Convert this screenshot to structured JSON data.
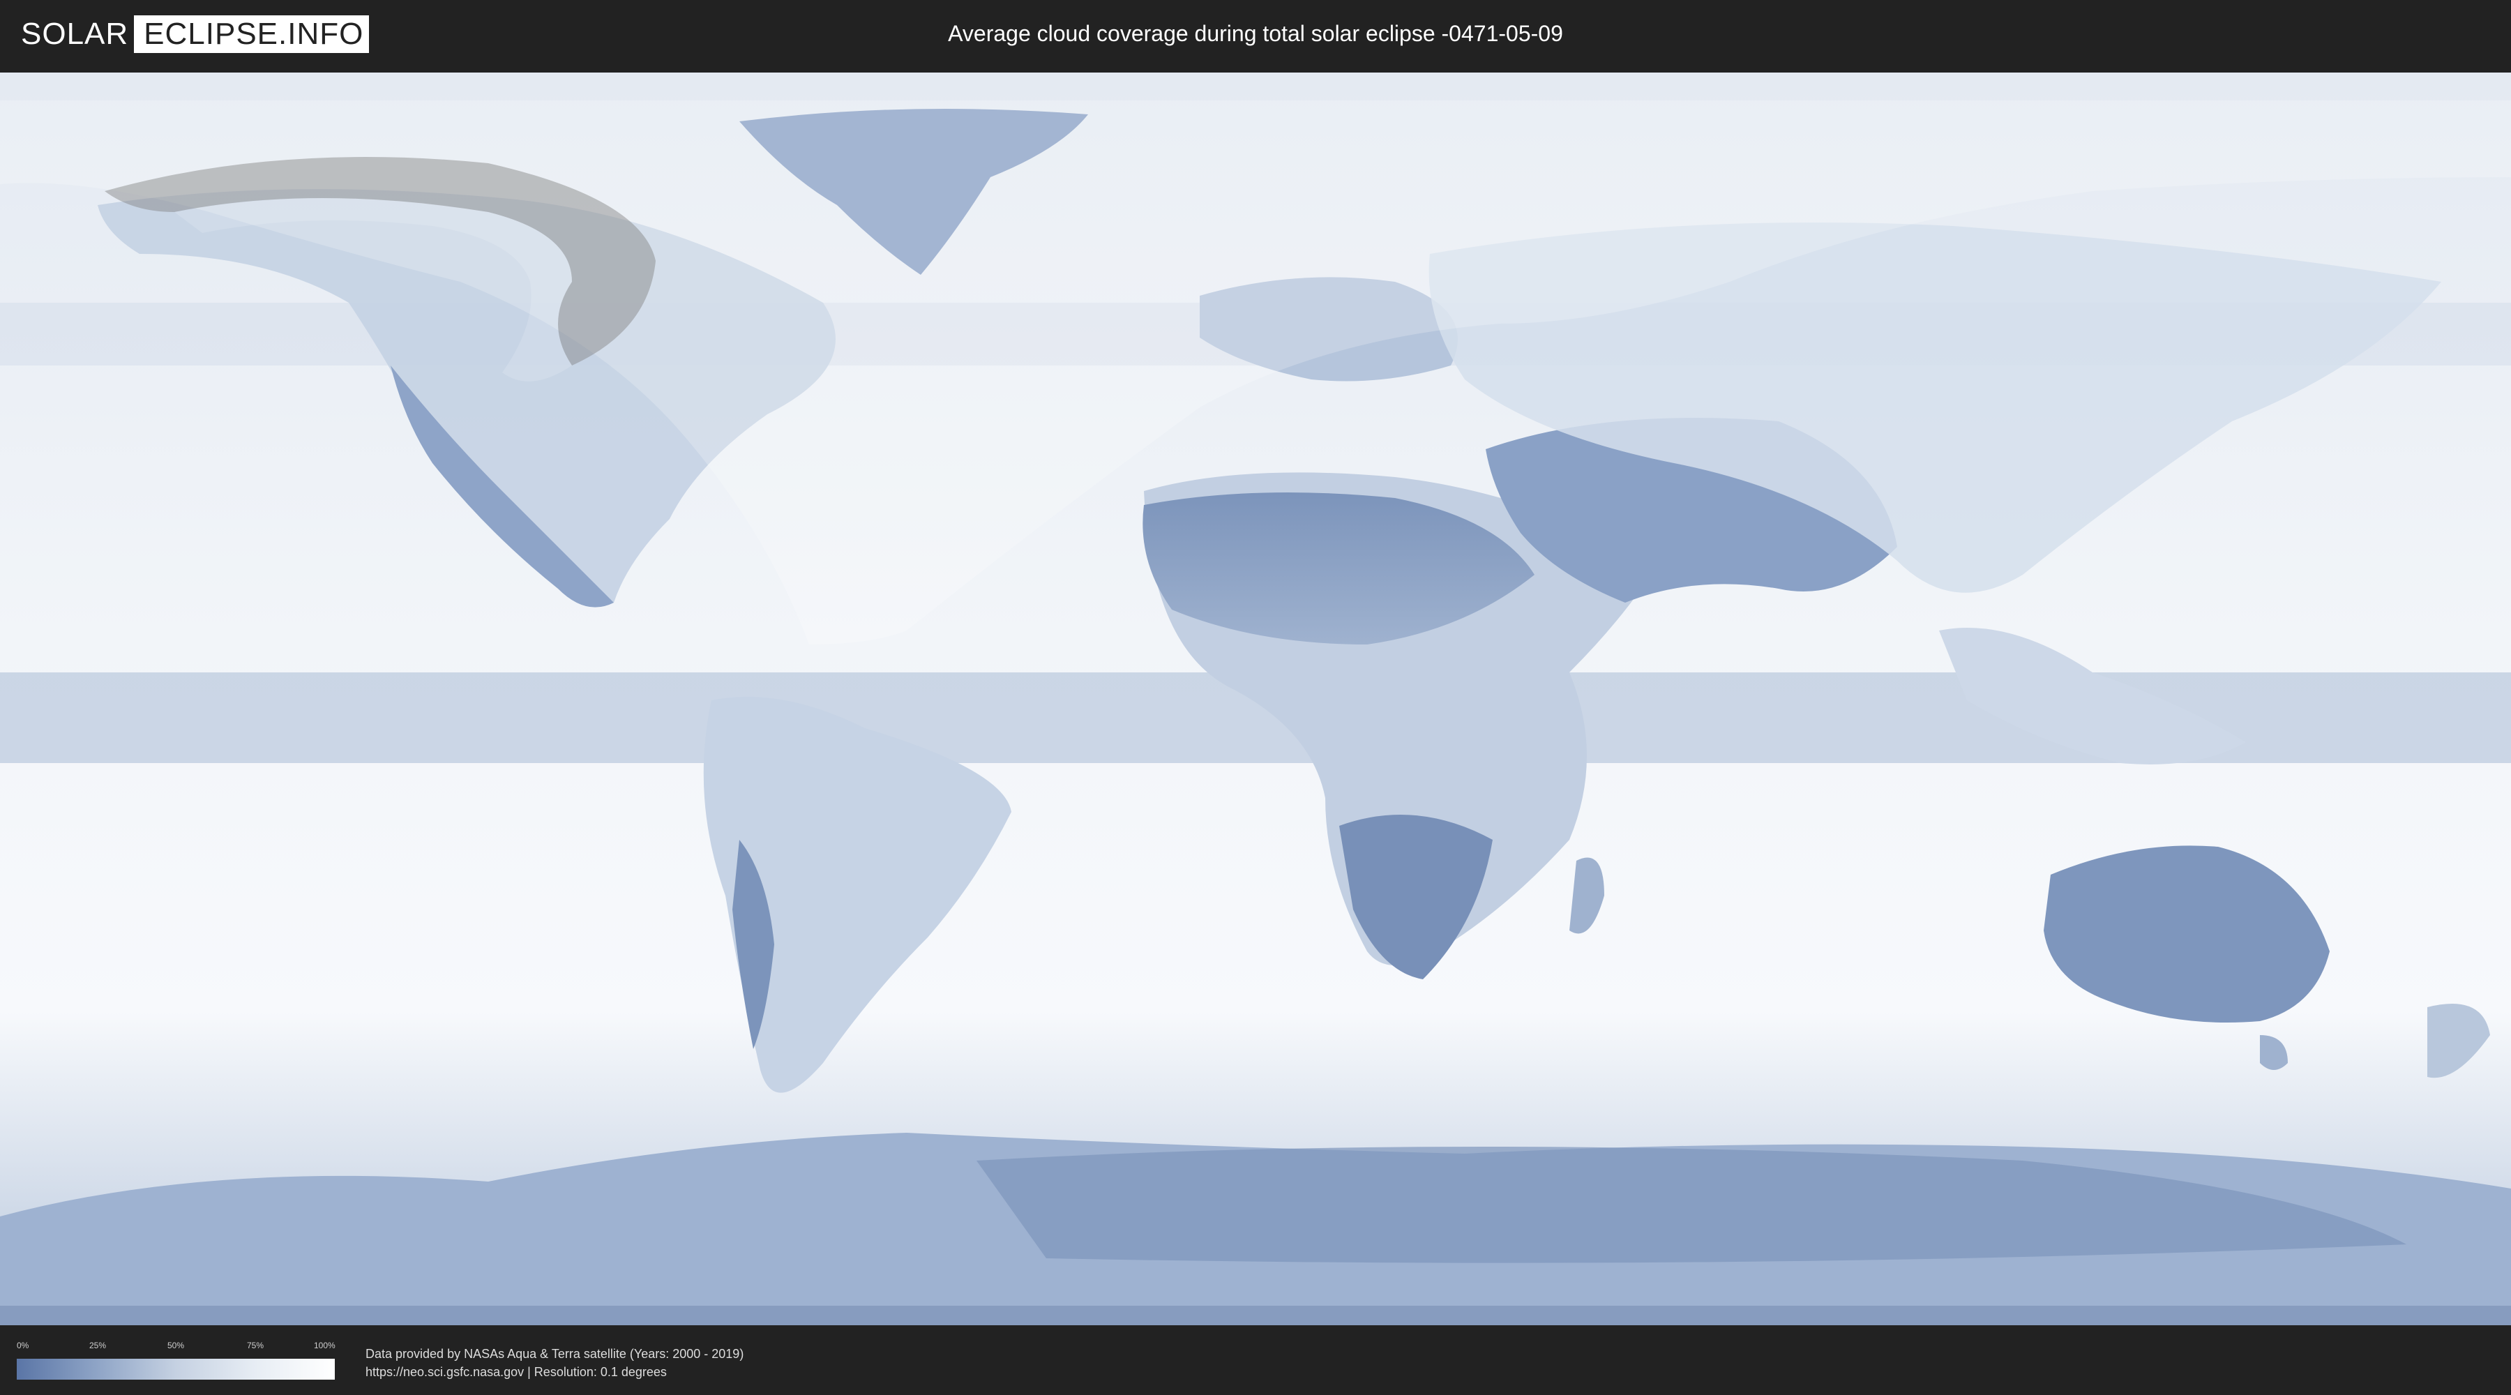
{
  "header": {
    "logo": {
      "part1": "SOLAR",
      "part2": "ECLIPSE.INFO"
    },
    "title": "Average cloud coverage during total solar eclipse -0471-05-09"
  },
  "legend": {
    "ticks": [
      "0%",
      "25%",
      "50%",
      "75%",
      "100%"
    ],
    "colors": {
      "low": "#5a75a6",
      "high": "#ffffff"
    }
  },
  "footer": {
    "credit_line1": "Data provided by NASAs Aqua & Terra satellite (Years: 2000 - 2019)",
    "credit_line2": "https://neo.sci.gsfc.nasa.gov | Resolution: 0.1 degrees"
  },
  "colors": {
    "header_bg": "#222222",
    "cloud_clear": "#5a75a6",
    "cloud_full": "#ffffff",
    "eclipse_path": "#808080"
  }
}
